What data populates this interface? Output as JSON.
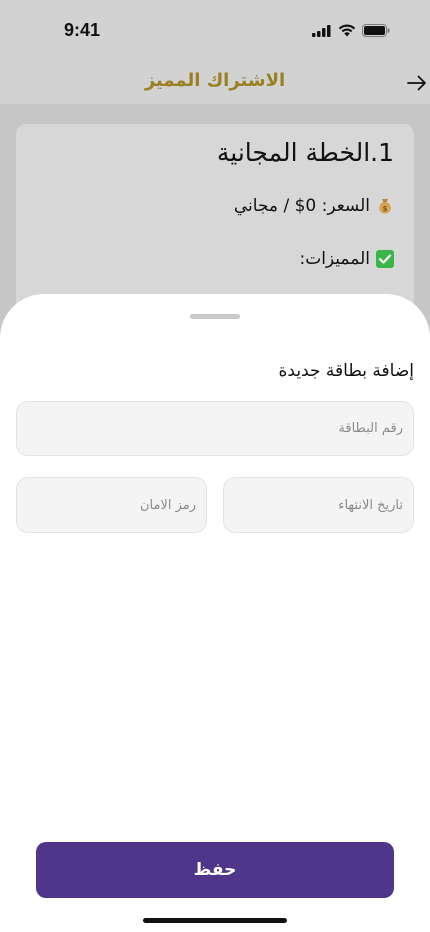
{
  "status_bar": {
    "time": "9:41",
    "icons": [
      "cellular-signal-icon",
      "wifi-icon",
      "battery-icon"
    ]
  },
  "nav": {
    "title": "الاشتراك المميز",
    "back_icon": "arrow-right-icon",
    "title_color": "#9a8020"
  },
  "plan": {
    "title": "1.الخطة المجانية",
    "price_emoji": "money-bag-icon",
    "price_text": "السعر: 0$ / مجاني",
    "features_emoji": "check-mark-icon",
    "features_text": "المميزات:"
  },
  "sheet": {
    "title": "إضافة بطاقة جديدة",
    "card_number": {
      "placeholder": "رقم البطاقة",
      "value": ""
    },
    "expiry": {
      "placeholder": "تاريخ الانتهاء",
      "value": ""
    },
    "cvv": {
      "placeholder": "رمز الامان",
      "value": ""
    },
    "save_label": "حفظ"
  },
  "colors": {
    "accent": "#4f368b",
    "scrim": "#c6c6c6",
    "check": "#3bb54a"
  }
}
